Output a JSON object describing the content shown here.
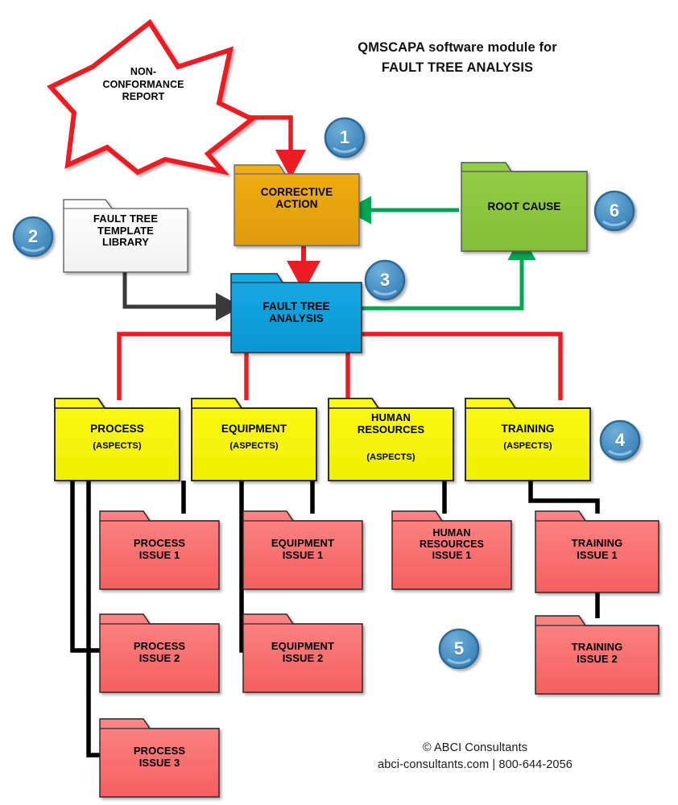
{
  "diagram": {
    "title_line1": "QMSCAPA software module for",
    "title_line2": "FAULT TREE ANALYSIS",
    "source_star": {
      "label": "NON-\nCONFORMANCE\nREPORT",
      "shape": "7-point-star",
      "stroke": "#ED1C24",
      "fill": "#FFFFFF"
    },
    "footer": {
      "line1": "© ABCI Consultants",
      "line2": "abci-consultants.com | 800-644-2056"
    },
    "palette": {
      "orange": "#E8A317",
      "blue": "#0FA0DC",
      "green": "#8CC63E",
      "yellow": "#F5F500",
      "salmon": "#F97272",
      "white": "#FCFCFC",
      "red_arrow": "#ED1C24",
      "green_arrow": "#00A651",
      "black_arrow": "#000000",
      "gray_arrow": "#3A3A3A",
      "badge_fill": "#4A90C4",
      "badge_stroke": "#2E6B96"
    },
    "nodes": [
      {
        "id": "corrective-action",
        "label": "CORRECTIVE\nACTION",
        "color": "orange"
      },
      {
        "id": "fault-tree-template-library",
        "label": "FAULT TREE\nTEMPLATE\nLIBRARY",
        "color": "white"
      },
      {
        "id": "fault-tree-analysis",
        "label": "FAULT TREE\nANALYSIS",
        "color": "blue"
      },
      {
        "id": "root-cause",
        "label": "ROOT CAUSE",
        "color": "green"
      },
      {
        "id": "process-aspects",
        "label": "PROCESS",
        "sublabel": "(ASPECTS)",
        "color": "yellow"
      },
      {
        "id": "equipment-aspects",
        "label": "EQUIPMENT",
        "sublabel": "(ASPECTS)",
        "color": "yellow"
      },
      {
        "id": "human-resources-aspects",
        "label": "HUMAN\nRESOURCES",
        "sublabel": "(ASPECTS)",
        "color": "yellow"
      },
      {
        "id": "training-aspects",
        "label": "TRAINING",
        "sublabel": "(ASPECTS)",
        "color": "yellow"
      },
      {
        "id": "process-issue-1",
        "label": "PROCESS\nISSUE 1",
        "color": "salmon"
      },
      {
        "id": "process-issue-2",
        "label": "PROCESS\nISSUE 2",
        "color": "salmon"
      },
      {
        "id": "process-issue-3",
        "label": "PROCESS\nISSUE 3",
        "color": "salmon"
      },
      {
        "id": "equipment-issue-1",
        "label": "EQUIPMENT\nISSUE 1",
        "color": "salmon"
      },
      {
        "id": "equipment-issue-2",
        "label": "EQUIPMENT\nISSUE 2",
        "color": "salmon"
      },
      {
        "id": "human-resources-issue-1",
        "label": "HUMAN\nRESOURCES\nISSUE 1",
        "color": "salmon"
      },
      {
        "id": "training-issue-1",
        "label": "TRAINING\nISSUE 1",
        "color": "salmon"
      },
      {
        "id": "training-issue-2",
        "label": "TRAINING\nISSUE 2",
        "color": "salmon"
      }
    ],
    "badges": [
      {
        "n": "1",
        "near": "corrective-action"
      },
      {
        "n": "2",
        "near": "fault-tree-template-library"
      },
      {
        "n": "3",
        "near": "fault-tree-analysis"
      },
      {
        "n": "4",
        "near": "training-aspects"
      },
      {
        "n": "5",
        "near": "issue-folders"
      },
      {
        "n": "6",
        "near": "root-cause"
      }
    ],
    "edges": [
      {
        "from": "source_star",
        "to": "corrective-action",
        "color": "red_arrow",
        "arrow": true
      },
      {
        "from": "corrective-action",
        "to": "fault-tree-analysis",
        "color": "red_arrow",
        "arrow": true
      },
      {
        "from": "fault-tree-template-library",
        "to": "fault-tree-analysis",
        "color": "gray_arrow",
        "arrow": true
      },
      {
        "from": "fault-tree-analysis",
        "to": "root-cause",
        "color": "green_arrow",
        "arrow": true
      },
      {
        "from": "root-cause",
        "to": "corrective-action",
        "color": "green_arrow",
        "arrow": true
      },
      {
        "from": "fault-tree-analysis",
        "to": "process-aspects",
        "color": "red_arrow",
        "arrow": false
      },
      {
        "from": "fault-tree-analysis",
        "to": "equipment-aspects",
        "color": "red_arrow",
        "arrow": false
      },
      {
        "from": "fault-tree-analysis",
        "to": "human-resources-aspects",
        "color": "red_arrow",
        "arrow": false
      },
      {
        "from": "fault-tree-analysis",
        "to": "training-aspects",
        "color": "red_arrow",
        "arrow": false
      },
      {
        "from": "process-aspects",
        "to": "process-issue-1",
        "color": "black_arrow",
        "arrow": false
      },
      {
        "from": "process-aspects",
        "to": "process-issue-2",
        "color": "black_arrow",
        "arrow": false
      },
      {
        "from": "process-aspects",
        "to": "process-issue-3",
        "color": "black_arrow",
        "arrow": false
      },
      {
        "from": "equipment-aspects",
        "to": "equipment-issue-1",
        "color": "black_arrow",
        "arrow": false
      },
      {
        "from": "equipment-aspects",
        "to": "equipment-issue-2",
        "color": "black_arrow",
        "arrow": false
      },
      {
        "from": "human-resources-aspects",
        "to": "human-resources-issue-1",
        "color": "black_arrow",
        "arrow": false
      },
      {
        "from": "training-aspects",
        "to": "training-issue-1",
        "color": "black_arrow",
        "arrow": false
      },
      {
        "from": "training-issue-1",
        "to": "training-issue-2",
        "color": "black_arrow",
        "arrow": false
      }
    ]
  }
}
